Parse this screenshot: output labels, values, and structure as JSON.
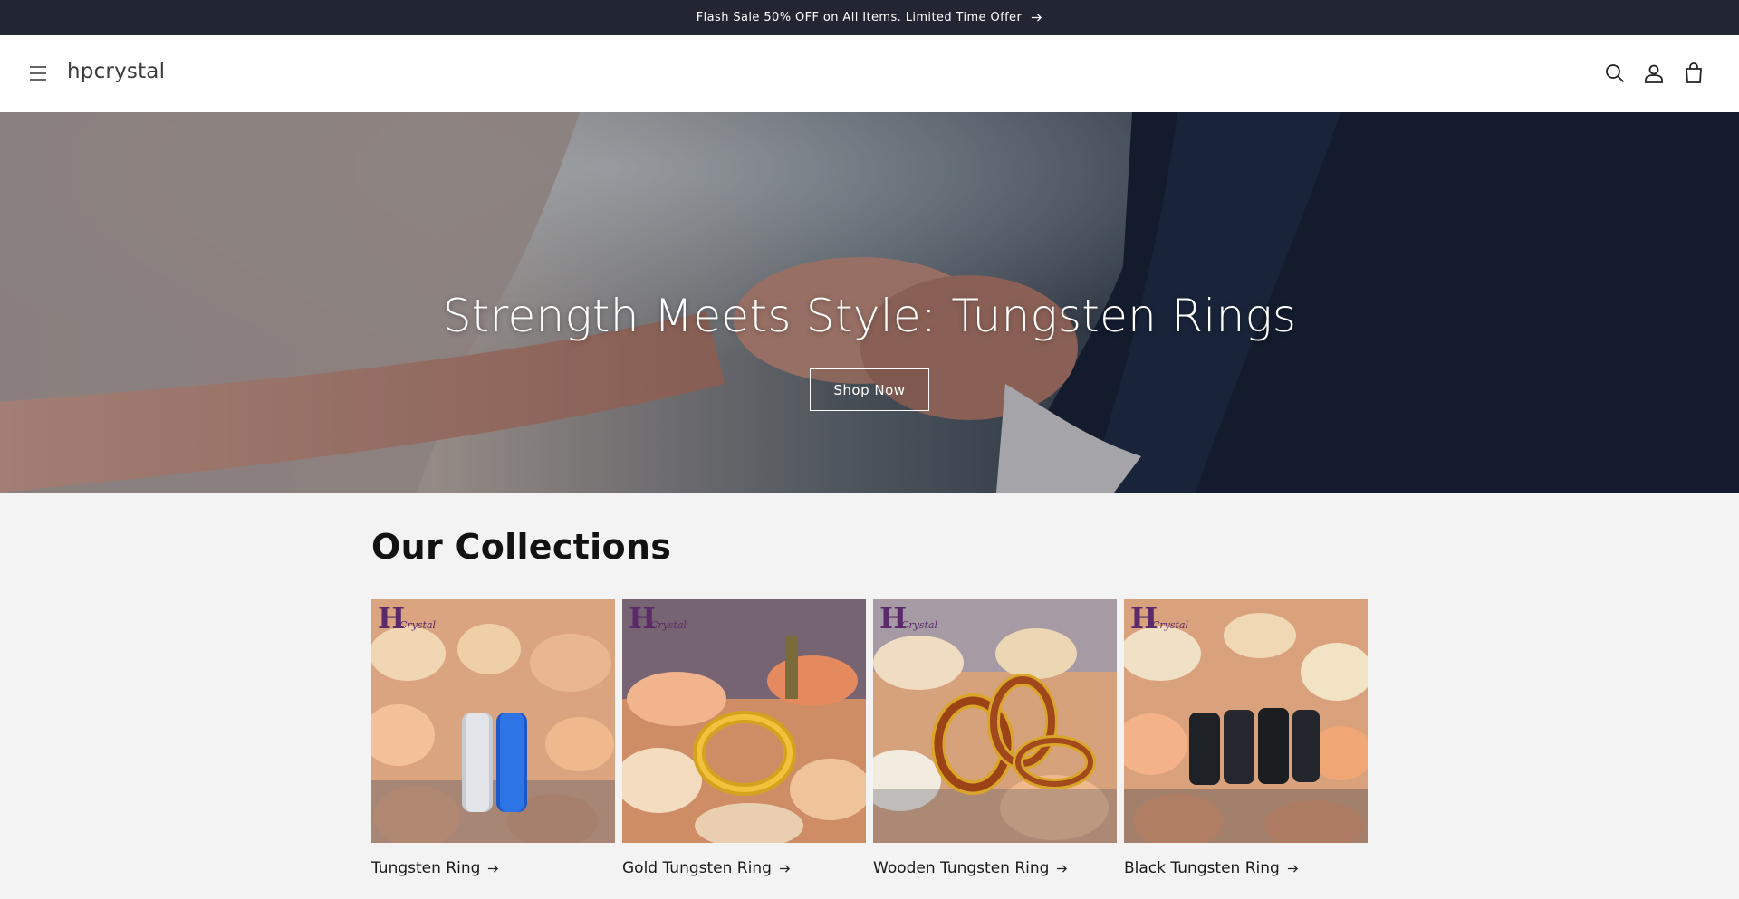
{
  "announcement": {
    "text": "Flash Sale 50% OFF on All Items. Limited Time Offer"
  },
  "header": {
    "brand": "hpcrystal",
    "icons": [
      "menu-icon",
      "search-icon",
      "account-icon",
      "cart-icon"
    ]
  },
  "hero": {
    "title": "Strength Meets Style: Tungsten Rings",
    "button_label": "Shop Now"
  },
  "collections": {
    "title": "Our Collections",
    "items": [
      {
        "label": "Tungsten Ring"
      },
      {
        "label": "Gold Tungsten Ring"
      },
      {
        "label": "Wooden Tungsten Ring"
      },
      {
        "label": "Black Tungsten Ring"
      }
    ],
    "logo_text": {
      "big": "H",
      "small": "Crystal"
    }
  },
  "colors": {
    "announcement_bg": "#222632",
    "header_bg": "#ffffff",
    "page_bg": "#f3f3f3",
    "text": "#121212"
  }
}
